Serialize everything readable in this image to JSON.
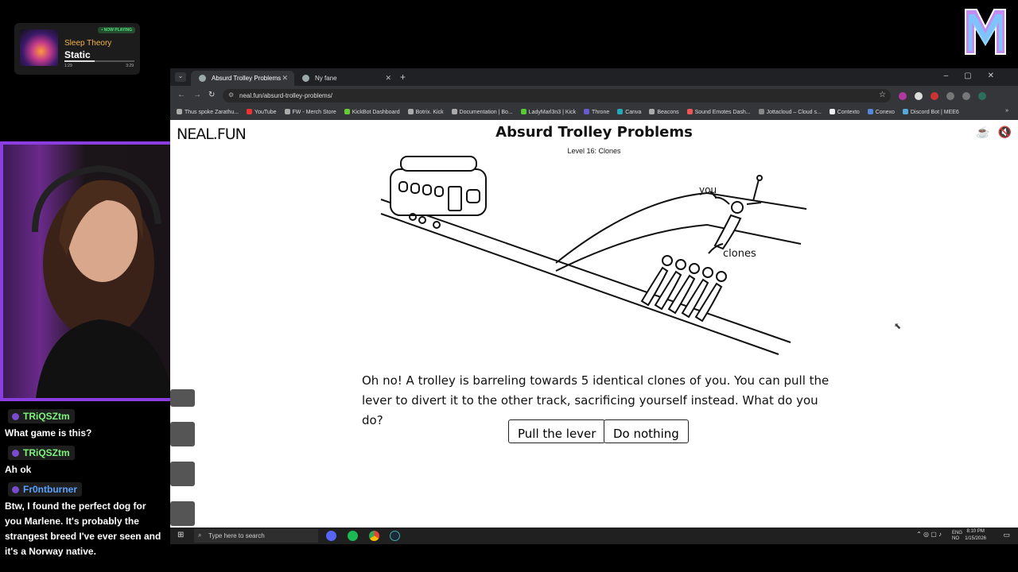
{
  "now_playing": {
    "badge": "• NOW PLAYING",
    "artist": "Sleep Theory",
    "title": "Static",
    "elapsed": "1:29",
    "duration": "3:29",
    "progress": 0.43
  },
  "chat": [
    {
      "user": "TRiQSZtm",
      "color": "#7cf27c",
      "message": "What game is this?"
    },
    {
      "user": "TRiQSZtm",
      "color": "#7cf27c",
      "message": "Ah ok"
    },
    {
      "user": "Fr0ntburner",
      "color": "#5aa0ff",
      "message": "Btw, I found the perfect dog for you Marlene. It's probably the strangest breed I've ever seen and it's a Norway native."
    }
  ],
  "browser": {
    "tabs": [
      {
        "label": "Absurd Trolley Problems",
        "active": true
      },
      {
        "label": "Ny fane",
        "active": false
      }
    ],
    "url": "neal.fun/absurd-trolley-problems/",
    "bookmarks": [
      "Thus spoke Zarathu...",
      "YouTube",
      "FW - Merch Store",
      "KickBot Dashboard",
      "Botrix. Kick",
      "Documentation | Bo...",
      "LadyMarl3n3 | Kick",
      "Throne",
      "Canva",
      "Beacons",
      "Sound Emotes Dash...",
      "Jottacloud – Cloud s...",
      "Contexto",
      "Conexo",
      "Discord Bot | MEE6"
    ]
  },
  "game": {
    "site_logo": "NEAL.FUN",
    "title": "Absurd Trolley Problems",
    "level": "Level 16: Clones",
    "label_you": "you",
    "label_clones": "clones",
    "question": "Oh no! A trolley is barreling towards 5 identical clones of you. You can pull the lever to divert it to the other track, sacrificing yourself instead. What do you do?",
    "buttons": {
      "pull": "Pull the lever",
      "nothing": "Do nothing"
    }
  },
  "taskbar": {
    "search_placeholder": "Type here to search",
    "lang": "ENG",
    "region": "NO",
    "time": "8:10 PM",
    "date": "1/15/2026"
  }
}
